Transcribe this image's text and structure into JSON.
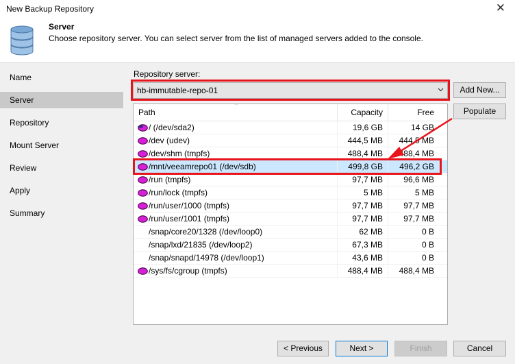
{
  "window": {
    "title": "New Backup Repository",
    "close_glyph": "✕"
  },
  "header": {
    "title": "Server",
    "description": "Choose repository server. You can select server from the list of managed servers added to the console.",
    "icon": "database-icon"
  },
  "sidebar": {
    "items": [
      {
        "label": "Name"
      },
      {
        "label": "Server",
        "active": true
      },
      {
        "label": "Repository"
      },
      {
        "label": "Mount Server"
      },
      {
        "label": "Review"
      },
      {
        "label": "Apply"
      },
      {
        "label": "Summary"
      }
    ]
  },
  "server": {
    "label": "Repository server:",
    "selected": "hb-immutable-repo-01",
    "add_new_label": "Add New...",
    "populate_label": "Populate"
  },
  "table": {
    "columns": [
      "Path",
      "Capacity",
      "Free"
    ],
    "sort_glyph": "⌃",
    "rows": [
      {
        "path": "/ (/dev/sda2)",
        "capacity": "19,6 GB",
        "free": "14 GB",
        "icon": "disk-icon-partial"
      },
      {
        "path": "/dev (udev)",
        "capacity": "444,5 MB",
        "free": "444,5 MB",
        "icon": "disk-icon"
      },
      {
        "path": "/dev/shm (tmpfs)",
        "capacity": "488,4 MB",
        "free": "488,4 MB",
        "icon": "disk-icon"
      },
      {
        "path": "/mnt/veeamrepo01 (/dev/sdb)",
        "capacity": "499,8 GB",
        "free": "496,2 GB",
        "icon": "disk-icon",
        "selected": true
      },
      {
        "path": "/run (tmpfs)",
        "capacity": "97,7 MB",
        "free": "96,6 MB",
        "icon": "disk-icon"
      },
      {
        "path": "/run/lock (tmpfs)",
        "capacity": "5 MB",
        "free": "5 MB",
        "icon": "disk-icon"
      },
      {
        "path": "/run/user/1000 (tmpfs)",
        "capacity": "97,7 MB",
        "free": "97,7 MB",
        "icon": "disk-icon"
      },
      {
        "path": "/run/user/1001 (tmpfs)",
        "capacity": "97,7 MB",
        "free": "97,7 MB",
        "icon": "disk-icon"
      },
      {
        "path": "/snap/core20/1328 (/dev/loop0)",
        "capacity": "62 MB",
        "free": "0 B",
        "icon": ""
      },
      {
        "path": "/snap/lxd/21835 (/dev/loop2)",
        "capacity": "67,3 MB",
        "free": "0 B",
        "icon": ""
      },
      {
        "path": "/snap/snapd/14978 (/dev/loop1)",
        "capacity": "43,6 MB",
        "free": "0 B",
        "icon": ""
      },
      {
        "path": "/sys/fs/cgroup (tmpfs)",
        "capacity": "488,4 MB",
        "free": "488,4 MB",
        "icon": "disk-icon"
      }
    ]
  },
  "footer": {
    "previous_label": "< Previous",
    "next_label": "Next >",
    "finish_label": "Finish",
    "cancel_label": "Cancel"
  },
  "colors": {
    "highlight_red": "#e8141b",
    "disk_magenta": "#d61fd6",
    "selection_blue": "#cce8ff"
  }
}
